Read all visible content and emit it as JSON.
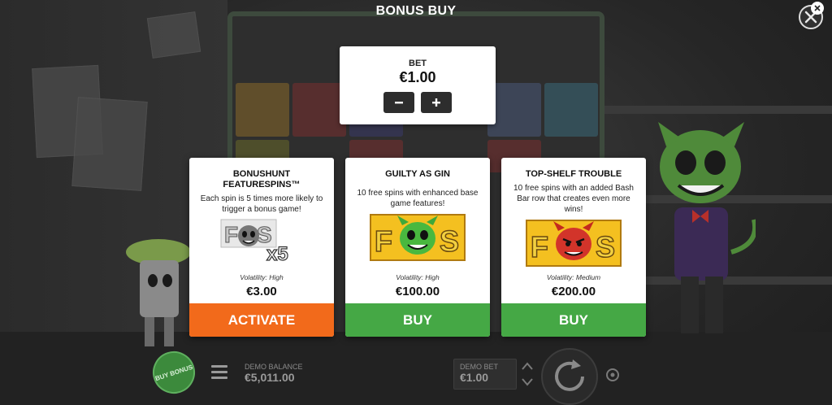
{
  "header": {
    "title": "BONUS BUY"
  },
  "bet": {
    "label": "BET",
    "value": "€1.00",
    "decrease_icon": "minus-icon",
    "increase_icon": "plus-icon"
  },
  "cards": [
    {
      "title": "BONUSHUNT FEATURESPINS™",
      "description": "Each spin is 5 times more likely to trigger a bonus game!",
      "art_text": "x5",
      "volatility": "Volatility: High",
      "price": "€3.00",
      "action": "ACTIVATE",
      "action_color": "#f26a1b"
    },
    {
      "title": "GUILTY AS GIN",
      "description": "10 free spins with enhanced base game features!",
      "volatility": "Volatility: High",
      "price": "€100.00",
      "action": "BUY",
      "action_color": "#45a845"
    },
    {
      "title": "TOP-SHELF TROUBLE",
      "description": "10 free spins with an added Bash Bar row that creates even more wins!",
      "volatility": "Volatility: Medium",
      "price": "€200.00",
      "action": "BUY",
      "action_color": "#45a845"
    }
  ],
  "bottom_bar": {
    "buy_bonus_label": "BUY BONUS",
    "balance_label": "DEMO BALANCE",
    "balance_value": "€5,011.00",
    "demo_bet_label": "DEMO BET",
    "demo_bet_value": "€1.00"
  },
  "colors": {
    "activate": "#f26a1b",
    "buy": "#45a845",
    "panel": "#ffffff",
    "background": "#2a2a2a"
  }
}
